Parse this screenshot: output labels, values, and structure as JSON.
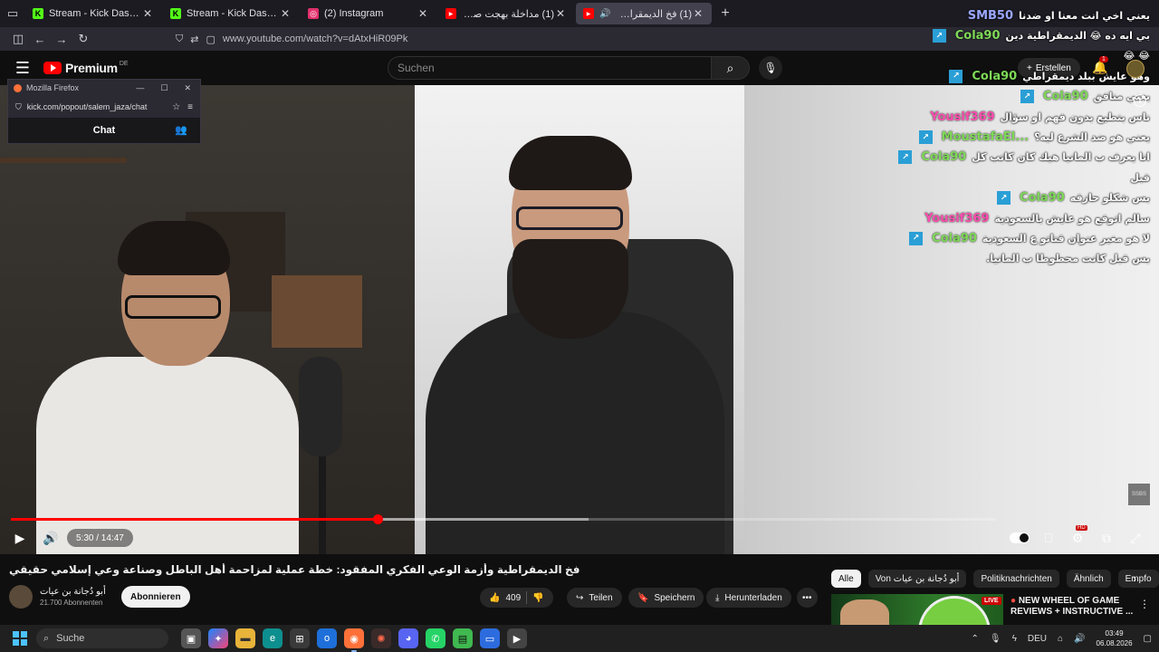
{
  "browser": {
    "tabs": [
      {
        "title": "Stream - Kick Dashboard",
        "favicon": "K",
        "favicon_color": "#53fc18",
        "active": false
      },
      {
        "title": "Stream - Kick Dashboard",
        "favicon": "K",
        "favicon_color": "#53fc18",
        "active": false
      },
      {
        "title": "(2) Instagram",
        "favicon": "◎",
        "favicon_color": "#e1306c",
        "active": false
      },
      {
        "title": "(1) مداخلة بهجت صابر وإبراهيم ...",
        "favicon": "▶",
        "favicon_color": "#ff0000",
        "active": false
      },
      {
        "title": "(1) فخ الديمقراطية وأزمة الو...",
        "favicon": "▶",
        "favicon_color": "#ff0000",
        "active": true,
        "muted": true
      }
    ],
    "url": "www.youtube.com/watch?v=dAtxHiR09Pk"
  },
  "popout": {
    "window_title": "Mozilla Firefox",
    "url": "kick.com/popout/salem_jaza/chat",
    "chat_label": "Chat"
  },
  "youtube": {
    "logo_text": "Premium",
    "region": "DE",
    "search_placeholder": "Suchen",
    "create_label": "Erstellen",
    "notification_count": "1"
  },
  "chat_messages": [
    {
      "user": "SMB50",
      "text": "يعني اخي انت معنا او ضدنا",
      "color": "#9aa7ff",
      "kick": false
    },
    {
      "user": "Cola90",
      "text": "بي ايه ده 😂 الديمقراطية دين",
      "color": "#7ed957",
      "kick": true
    },
    {
      "user": "",
      "text": "😂 😂",
      "color": "#ffffff",
      "kick": false
    },
    {
      "user": "Cola90",
      "text": "وهو عايش ببلد ديمقراطي",
      "color": "#7ed957",
      "kick": true
    },
    {
      "user": "Cola90",
      "text": "يعني منافق",
      "color": "#7ed957",
      "kick": true
    },
    {
      "user": "Yousif369",
      "text": "ناس بتطيع بدون فهم او سؤال",
      "color": "#ff4fb0",
      "kick": false
    },
    {
      "user": "MoustafaEl...",
      "text": "يعني هو ضد الشرع ليه؟",
      "color": "#7ed957",
      "kick": true
    },
    {
      "user": "Cola90",
      "text": "انا يعرف ب المانيا هيك كان كاتب كل",
      "color": "#7ed957",
      "kick": true
    },
    {
      "user": "",
      "text": "قبل",
      "color": "#ffffff",
      "kick": false
    },
    {
      "user": "Cola90",
      "text": "بس شكلو حازقه",
      "color": "#7ed957",
      "kick": true
    },
    {
      "user": "Yousif369",
      "text": "سالم اتوقع هو عايش بالسعودية",
      "color": "#ff4fb0",
      "kick": false
    },
    {
      "user": "Cola90",
      "text": "لا هو مغير عنوان قناتو ع السعودية",
      "color": "#7ed957",
      "kick": true
    },
    {
      "user": "",
      "text": "بس قبل كانت محطوطا ب المانيا.",
      "color": "#ffffff",
      "kick": false
    }
  ],
  "player": {
    "current_time": "5:30",
    "duration": "14:47",
    "time_label": "5:30 / 14:47",
    "progress_fraction": 0.372,
    "buffer_fraction": 0.5861,
    "hd_badge": "HD",
    "watermark": "SSBS"
  },
  "video": {
    "title": "فخ الديمقراطية وأزمة الوعي الفكري المفقود: خطة عملية لمزاحمة أهل الباطل وصناعة وعي إسلامي حقيقي",
    "channel_name": "أبو دُجانة بن عيات",
    "subscribers": "21.700 Abonnenten",
    "subscribe_label": "Abonnieren",
    "like_count": "409",
    "share_label": "Teilen",
    "save_label": "Speichern",
    "download_label": "Herunterladen"
  },
  "chips": [
    "Alle",
    "Von أبو دُجانة بن عيات",
    "Politiknachrichten",
    "Ähnlich",
    "Empfo"
  ],
  "recommendation": {
    "title_line1": "NEW WHEEL OF GAME",
    "title_line2": "REVIEWS + INSTRUCTIVE ...",
    "live_label": "LIVE"
  },
  "taskbar": {
    "search_label": "Suche",
    "language": "DEU",
    "time": "03:49",
    "date": "06.08.2026"
  }
}
